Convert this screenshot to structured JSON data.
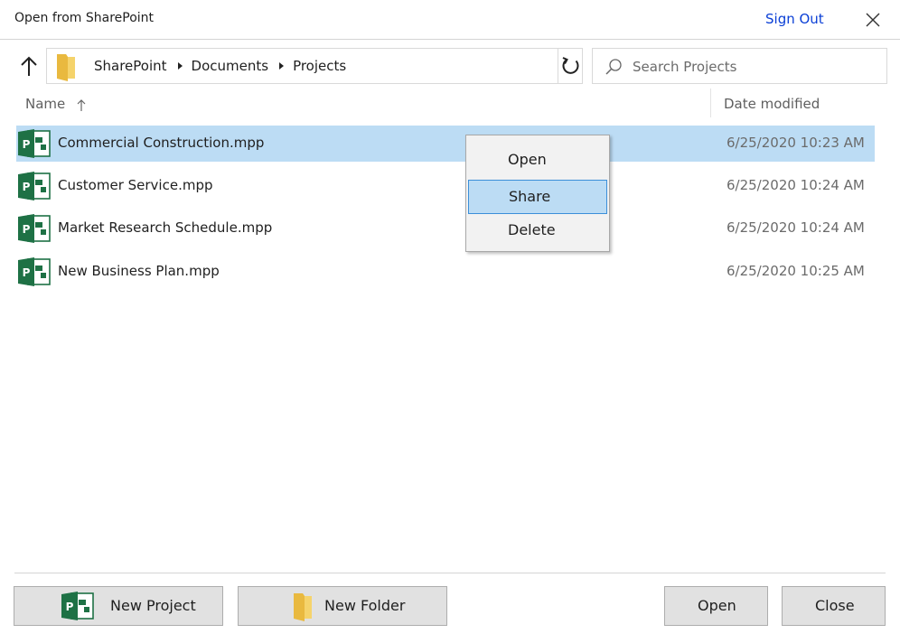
{
  "window": {
    "title": "Open from SharePoint",
    "sign_out_label": "Sign Out"
  },
  "navigation": {
    "breadcrumbs": [
      "SharePoint",
      "Documents",
      "Projects"
    ],
    "search_placeholder": "Search Projects"
  },
  "columns": {
    "name": "Name",
    "date_modified": "Date modified"
  },
  "files": [
    {
      "name": "Commercial Construction.mpp",
      "date": "6/25/2020 10:23 AM",
      "selected": true
    },
    {
      "name": "Customer Service.mpp",
      "date": "6/25/2020 10:24 AM",
      "selected": false
    },
    {
      "name": "Market Research Schedule.mpp",
      "date": "6/25/2020 10:24 AM",
      "selected": false
    },
    {
      "name": "New Business Plan.mpp",
      "date": "6/25/2020 10:25 AM",
      "selected": false
    }
  ],
  "context_menu": {
    "items": [
      "Open",
      "Share",
      "Delete"
    ],
    "hovered": "Share"
  },
  "footer": {
    "new_project_label": "New Project",
    "new_folder_label": "New Folder",
    "open_label": "Open",
    "close_label": "Close"
  },
  "colors": {
    "selection": "#bcdcf4",
    "link": "#0a3fd6",
    "project_green": "#1e7145",
    "folder_yellow": "#f5d36b"
  },
  "icons": {
    "close": "close-icon",
    "up": "arrow-up-icon",
    "folder": "folder-icon",
    "refresh": "refresh-icon",
    "search": "search-icon",
    "project_file": "project-file-icon"
  }
}
